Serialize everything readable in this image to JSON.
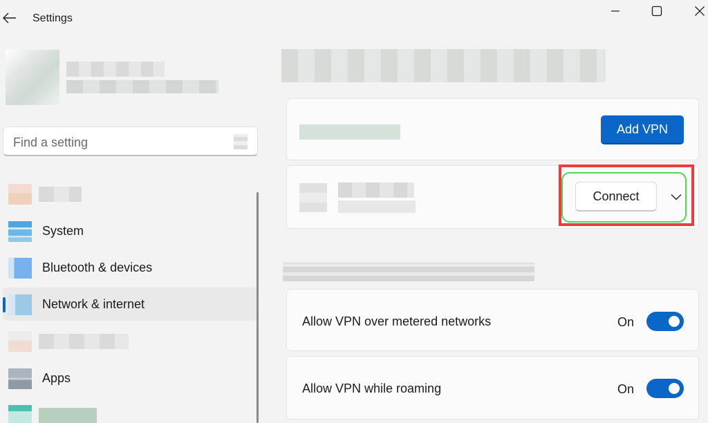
{
  "window": {
    "title": "Settings"
  },
  "search": {
    "placeholder": "Find a setting"
  },
  "sidebar": {
    "items": [
      {
        "label": ""
      },
      {
        "label": "System"
      },
      {
        "label": "Bluetooth & devices"
      },
      {
        "label": "Network & internet",
        "active": true
      },
      {
        "label": ""
      },
      {
        "label": "Apps"
      },
      {
        "label": ""
      }
    ]
  },
  "vpn": {
    "add_button": "Add VPN",
    "connect_button": "Connect"
  },
  "advanced": {
    "metered": {
      "label": "Allow VPN over metered networks",
      "state": "On"
    },
    "roaming": {
      "label": "Allow VPN while roaming",
      "state": "On"
    }
  },
  "colors": {
    "accent": "#0a66c8",
    "highlight_red": "#ee3b3b",
    "highlight_green": "#4fd74f"
  },
  "icons": {
    "back": "arrow-left-icon",
    "minimize": "minimize-icon",
    "maximize": "maximize-icon",
    "close": "close-icon",
    "search": "search-icon",
    "expand": "chevron-down-icon"
  }
}
